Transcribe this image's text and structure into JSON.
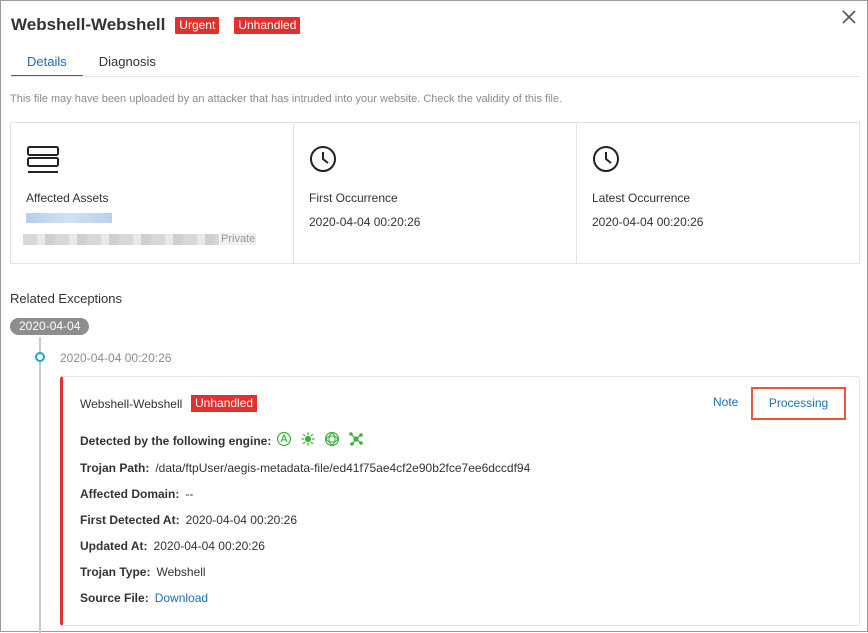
{
  "header": {
    "title": "Webshell-Webshell",
    "severity_badge": "Urgent",
    "status_badge": "Unhandled"
  },
  "tabs": [
    {
      "label": "Details",
      "active": true
    },
    {
      "label": "Diagnosis",
      "active": false
    }
  ],
  "notice": "This file may have been uploaded by an attacker that has intruded into your website. Check the validity of this file.",
  "cards": {
    "assets": {
      "label": "Affected Assets",
      "ip_tag": "Private"
    },
    "first": {
      "label": "First Occurrence",
      "value": "2020-04-04 00:20:26"
    },
    "latest": {
      "label": "Latest Occurrence",
      "value": "2020-04-04 00:20:26"
    }
  },
  "related": {
    "title": "Related Exceptions",
    "date_group": "2020-04-04",
    "time": "2020-04-04 00:20:26"
  },
  "event": {
    "title": "Webshell-Webshell",
    "status_badge": "Unhandled",
    "note_label": "Note",
    "processing_label": "Processing",
    "engine_label": "Detected by the following engine:",
    "trojan_path_label": "Trojan Path:",
    "trojan_path": "/data/ftpUser/aegis-metadata-file/ed41f75ae4cf2e90b2fce7ee6dccdf94",
    "domain_label": "Affected Domain:",
    "domain": "--",
    "first_detected_label": "First Detected At:",
    "first_detected": "2020-04-04 00:20:26",
    "updated_label": "Updated At:",
    "updated": "2020-04-04 00:20:26",
    "trojan_type_label": "Trojan Type:",
    "trojan_type": "Webshell",
    "source_file_label": "Source File:",
    "source_file_link": "Download"
  },
  "colors": {
    "accent": "#1a6fbe",
    "danger": "#e0312f",
    "highlight_border": "#e8593a",
    "engine_green": "#3cb43c"
  }
}
